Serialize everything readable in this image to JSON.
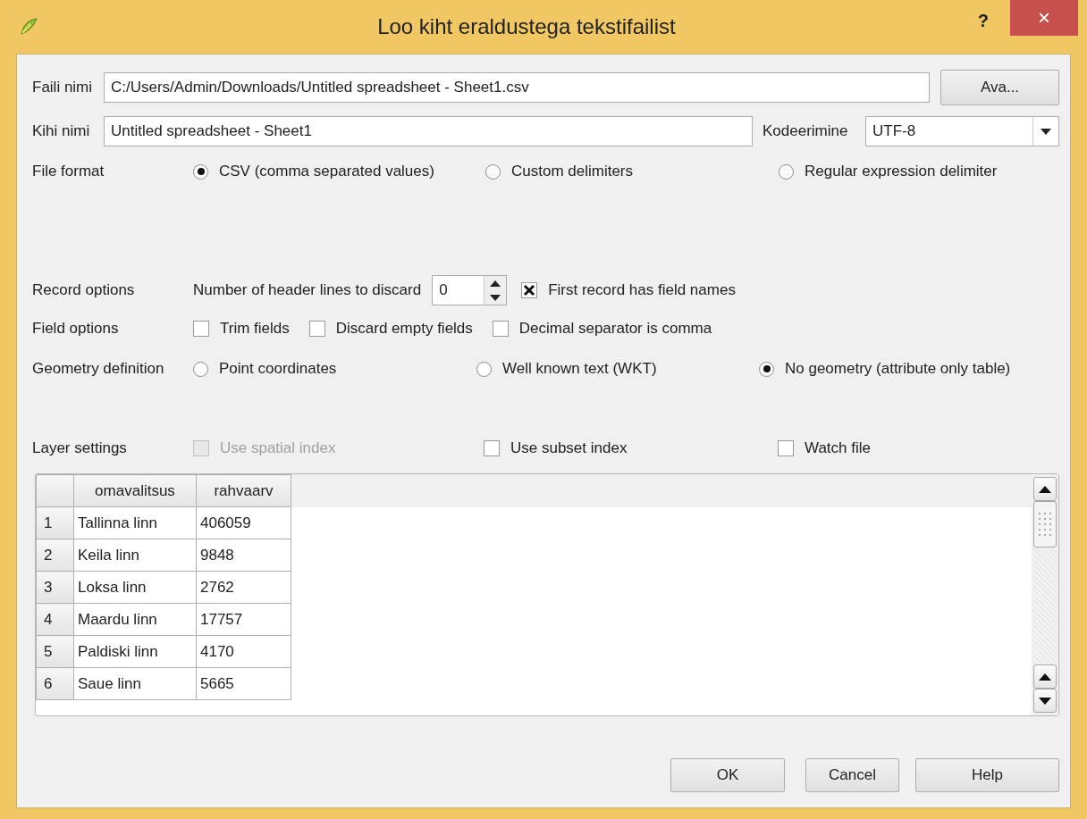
{
  "window": {
    "title": "Loo kiht eraldustega tekstifailist",
    "help_glyph": "?",
    "close_glyph": "×"
  },
  "file_name": {
    "label": "Faili nimi",
    "value": "C:/Users/Admin/Downloads/Untitled spreadsheet - Sheet1.csv",
    "button": "Ava..."
  },
  "layer_name": {
    "label": "Kihi nimi",
    "value": "Untitled spreadsheet - Sheet1"
  },
  "encoding": {
    "label": "Kodeerimine",
    "value": "UTF-8"
  },
  "file_format": {
    "label": "File format",
    "options": [
      {
        "label": "CSV (comma separated values)",
        "selected": true
      },
      {
        "label": "Custom delimiters",
        "selected": false
      },
      {
        "label": "Regular expression delimiter",
        "selected": false
      }
    ]
  },
  "record_options": {
    "label": "Record options",
    "header_lines_label": "Number of header lines to discard",
    "header_lines_value": "0",
    "first_record": {
      "label": "First record has field names",
      "checked": true
    }
  },
  "field_options": {
    "label": "Field options",
    "options": [
      {
        "label": "Trim fields",
        "checked": false
      },
      {
        "label": "Discard empty fields",
        "checked": false
      },
      {
        "label": "Decimal separator is comma",
        "checked": false
      }
    ]
  },
  "geometry_definition": {
    "label": "Geometry definition",
    "options": [
      {
        "label": "Point coordinates",
        "selected": false
      },
      {
        "label": "Well known text (WKT)",
        "selected": false
      },
      {
        "label": "No geometry (attribute only table)",
        "selected": true
      }
    ]
  },
  "layer_settings": {
    "label": "Layer settings",
    "options": [
      {
        "label": "Use spatial index",
        "checked": false,
        "disabled": true
      },
      {
        "label": "Use subset index",
        "checked": false,
        "disabled": false
      },
      {
        "label": "Watch file",
        "checked": false,
        "disabled": false
      }
    ]
  },
  "table": {
    "columns": [
      "omavalitsus",
      "rahvaarv"
    ],
    "rows": [
      {
        "number": "1",
        "cells": [
          "Tallinna linn",
          "406059"
        ]
      },
      {
        "number": "2",
        "cells": [
          "Keila linn",
          "9848"
        ]
      },
      {
        "number": "3",
        "cells": [
          "Loksa linn",
          "2762"
        ]
      },
      {
        "number": "4",
        "cells": [
          "Maardu linn",
          "17757"
        ]
      },
      {
        "number": "5",
        "cells": [
          "Paldiski linn",
          "4170"
        ]
      },
      {
        "number": "6",
        "cells": [
          "Saue linn",
          "5665"
        ]
      }
    ]
  },
  "buttons": [
    "OK",
    "Cancel",
    "Help"
  ]
}
